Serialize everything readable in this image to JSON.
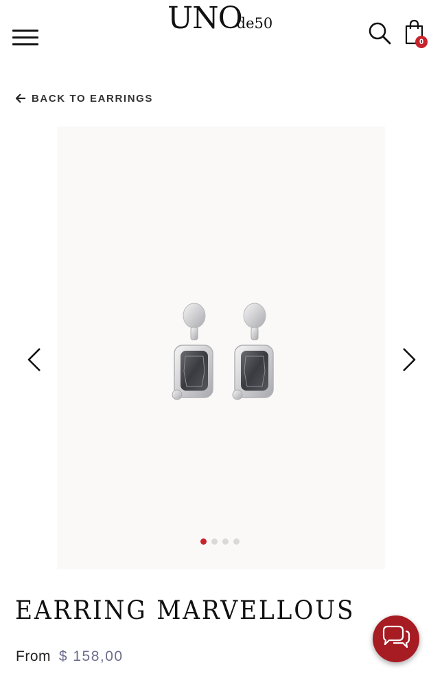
{
  "header": {
    "logo_main": "UNO",
    "logo_sub": "de50",
    "cart_count": "0"
  },
  "back_link": {
    "label": "BACK TO EARRINGS"
  },
  "gallery": {
    "image_count": 4,
    "active_index": 0
  },
  "product": {
    "title": "EARRING MARVELLOUS",
    "price_prefix": "From",
    "price": "$ 158,00"
  },
  "colors": {
    "accent_red": "#c8232c",
    "chat_red": "#a71b23",
    "price_color": "#6b6d8c",
    "gallery_bg": "#faf9f8"
  },
  "icons": [
    "hamburger-menu-icon",
    "search-icon",
    "shopping-bag-icon",
    "arrow-left-icon",
    "chevron-left-icon",
    "chevron-right-icon",
    "chat-icon"
  ]
}
